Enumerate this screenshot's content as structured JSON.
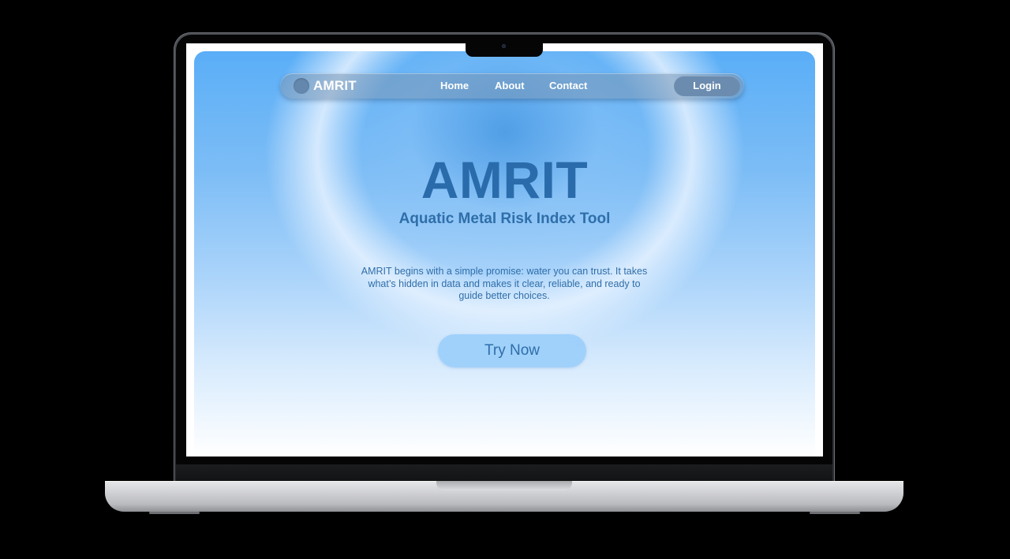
{
  "navbar": {
    "brand": "AMRIT",
    "links": [
      "Home",
      "About",
      "Contact"
    ],
    "login_label": "Login"
  },
  "hero": {
    "title": "AMRIT",
    "subtitle": "Aquatic Metal Risk Index Tool",
    "description": "AMRIT begins with a simple promise: water you can trust. It takes what’s hidden in data and makes it clear, reliable, and ready to guide better choices.",
    "cta_label": "Try Now"
  },
  "colors": {
    "accent": "#2a6bab",
    "navbar_bg": "#7896b4",
    "login_bg": "#6b8caf",
    "cta_bg": "#96cdfa"
  }
}
